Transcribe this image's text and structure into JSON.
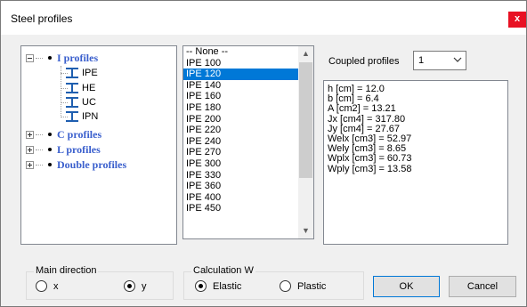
{
  "window": {
    "title": "Steel profiles",
    "close_label": "x"
  },
  "tree": {
    "categories": [
      {
        "label": "I profiles",
        "expanded": true,
        "children": [
          "IPE",
          "HE",
          "UC",
          "IPN"
        ]
      },
      {
        "label": "C profiles",
        "expanded": false
      },
      {
        "label": "L profiles",
        "expanded": false
      },
      {
        "label": "Double profiles",
        "expanded": false
      }
    ]
  },
  "profile_list": {
    "items": [
      "-- None --",
      "IPE 100",
      "IPE 120",
      "IPE 140",
      "IPE 160",
      "IPE 180",
      "IPE 200",
      "IPE 220",
      "IPE 240",
      "IPE 270",
      "IPE 300",
      "IPE 330",
      "IPE 360",
      "IPE 400",
      "IPE 450"
    ],
    "selected": "IPE 120"
  },
  "coupled": {
    "label": "Coupled profiles",
    "value": "1"
  },
  "properties": [
    "h [cm] = 12.0",
    "b [cm] = 6.4",
    "A [cm2] = 13.21",
    "Jx [cm4] = 317.80",
    "Jy [cm4] = 27.67",
    "Welx [cm3] = 52.97",
    "Wely [cm3] = 8.65",
    "Wplx [cm3] = 60.73",
    "Wply [cm3] = 13.58"
  ],
  "main_direction": {
    "title": "Main direction",
    "options": [
      {
        "label": "x",
        "checked": false
      },
      {
        "label": "y",
        "checked": true
      }
    ]
  },
  "calculation": {
    "title": "Calculation W",
    "options": [
      {
        "label": "Elastic",
        "checked": true
      },
      {
        "label": "Plastic",
        "checked": false
      }
    ]
  },
  "buttons": {
    "ok": "OK",
    "cancel": "Cancel"
  },
  "colors": {
    "selection": "#0078d7",
    "tree_category": "#3a5fcd",
    "close": "#e81123",
    "ibeam_icon": "#1f5fb0"
  }
}
